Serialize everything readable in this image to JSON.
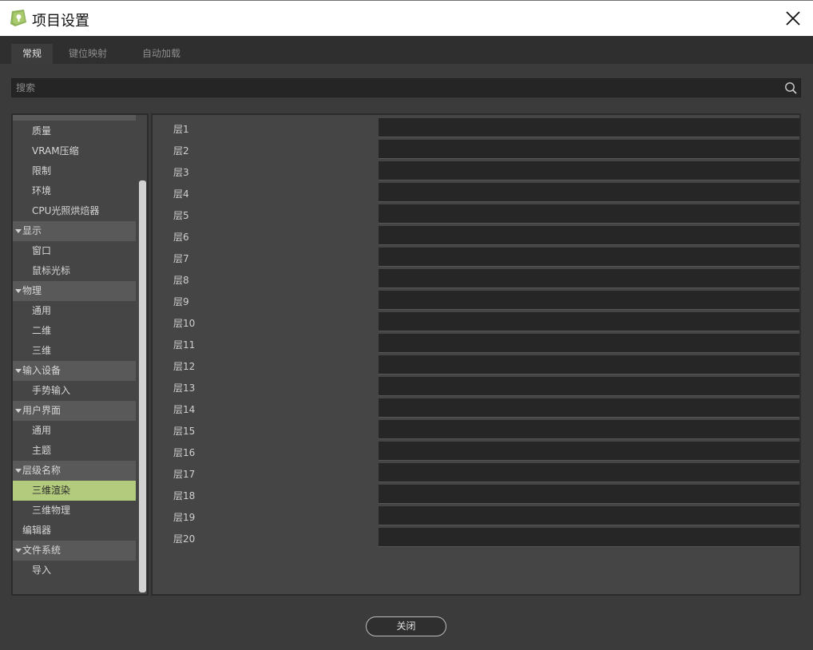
{
  "window": {
    "title": "项目设置",
    "icon": "godot-icon"
  },
  "tabs": [
    {
      "label": "常规",
      "active": true
    },
    {
      "label": "键位映射",
      "active": false
    },
    {
      "label": "自动加载",
      "active": false
    }
  ],
  "search": {
    "placeholder": "搜索",
    "value": ""
  },
  "tree": {
    "items": [
      {
        "label": "质量",
        "kind": "sub"
      },
      {
        "label": "VRAM压缩",
        "kind": "sub"
      },
      {
        "label": "限制",
        "kind": "sub"
      },
      {
        "label": "环境",
        "kind": "sub"
      },
      {
        "label": "CPU光照烘焙器",
        "kind": "sub"
      },
      {
        "label": "显示",
        "kind": "section"
      },
      {
        "label": "窗口",
        "kind": "sub"
      },
      {
        "label": "鼠标光标",
        "kind": "sub"
      },
      {
        "label": "物理",
        "kind": "section"
      },
      {
        "label": "通用",
        "kind": "sub"
      },
      {
        "label": "二维",
        "kind": "sub"
      },
      {
        "label": "三维",
        "kind": "sub"
      },
      {
        "label": "输入设备",
        "kind": "section"
      },
      {
        "label": "手势输入",
        "kind": "sub"
      },
      {
        "label": "用户界面",
        "kind": "section"
      },
      {
        "label": "通用",
        "kind": "sub"
      },
      {
        "label": "主题",
        "kind": "sub"
      },
      {
        "label": "层级名称",
        "kind": "section"
      },
      {
        "label": "三维渲染",
        "kind": "sub",
        "selected": true
      },
      {
        "label": "三维物理",
        "kind": "sub"
      },
      {
        "label": "编辑器",
        "kind": "plain"
      },
      {
        "label": "文件系统",
        "kind": "section"
      },
      {
        "label": "导入",
        "kind": "sub"
      }
    ]
  },
  "layers": [
    {
      "label": "层1",
      "value": ""
    },
    {
      "label": "层2",
      "value": ""
    },
    {
      "label": "层3",
      "value": ""
    },
    {
      "label": "层4",
      "value": ""
    },
    {
      "label": "层5",
      "value": ""
    },
    {
      "label": "层6",
      "value": ""
    },
    {
      "label": "层7",
      "value": ""
    },
    {
      "label": "层8",
      "value": ""
    },
    {
      "label": "层9",
      "value": ""
    },
    {
      "label": "层10",
      "value": ""
    },
    {
      "label": "层11",
      "value": ""
    },
    {
      "label": "层12",
      "value": ""
    },
    {
      "label": "层13",
      "value": ""
    },
    {
      "label": "层14",
      "value": ""
    },
    {
      "label": "层15",
      "value": ""
    },
    {
      "label": "层16",
      "value": ""
    },
    {
      "label": "层17",
      "value": ""
    },
    {
      "label": "层18",
      "value": ""
    },
    {
      "label": "层19",
      "value": ""
    },
    {
      "label": "层20",
      "value": ""
    }
  ],
  "footer": {
    "close_label": "关闭"
  },
  "colors": {
    "accent_selected": "#b3cb7c",
    "panel_bg": "#454545",
    "field_bg": "#262626"
  }
}
